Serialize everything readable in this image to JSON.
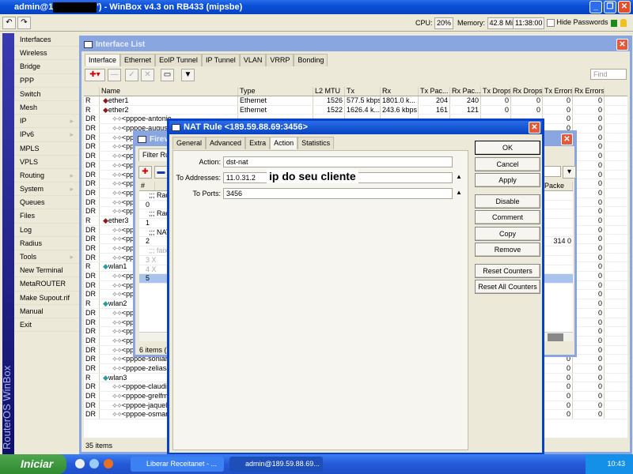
{
  "app": {
    "title_prefix": "admin@1",
    "title_suffix": "') - WinBox v4.3 on RB433 (mipsbe)"
  },
  "status": {
    "cpu_label": "CPU:",
    "cpu": "20%",
    "mem_label": "Memory:",
    "mem": "42.8 MiB",
    "time": "11:38:00",
    "hide_passwords": "Hide Passwords"
  },
  "sidebar": {
    "brand": "RouterOS WinBox",
    "items": [
      {
        "label": "Interfaces"
      },
      {
        "label": "Wireless"
      },
      {
        "label": "Bridge"
      },
      {
        "label": "PPP"
      },
      {
        "label": "Switch"
      },
      {
        "label": "Mesh"
      },
      {
        "label": "IP",
        "sub": true
      },
      {
        "label": "IPv6",
        "sub": true
      },
      {
        "label": "MPLS"
      },
      {
        "label": "VPLS"
      },
      {
        "label": "Routing",
        "sub": true
      },
      {
        "label": "System",
        "sub": true
      },
      {
        "label": "Queues"
      },
      {
        "label": "Files"
      },
      {
        "label": "Log"
      },
      {
        "label": "Radius"
      },
      {
        "label": "Tools",
        "sub": true
      },
      {
        "label": "New Terminal"
      },
      {
        "label": "MetaROUTER"
      },
      {
        "label": "Make Supout.rif"
      },
      {
        "label": "Manual"
      },
      {
        "label": "Exit"
      }
    ]
  },
  "iflist": {
    "title": "Interface List",
    "tabs": [
      "Interface",
      "Ethernet",
      "EoIP Tunnel",
      "IP Tunnel",
      "VLAN",
      "VRRP",
      "Bonding"
    ],
    "find_placeholder": "Find",
    "status": "35 items",
    "columns": [
      "",
      "Name",
      "Type",
      "L2 MTU",
      "Tx",
      "Rx",
      "Tx Pac...",
      "Rx Pac...",
      "Tx Drops",
      "Rx Drops",
      "Tx Errors",
      "Rx Errors"
    ],
    "rows": [
      [
        "R",
        "ether1",
        "Ethernet",
        "1526",
        "577.5 kbps",
        "1801.0 k...",
        "204",
        "240",
        "0",
        "0",
        "0",
        "0"
      ],
      [
        "R",
        "ether2",
        "Ethernet",
        "1522",
        "1626.4 k...",
        "243.6 kbps",
        "161",
        "121",
        "0",
        "0",
        "0",
        "0"
      ],
      [
        "DR",
        "<pppoe-antonio",
        "",
        "",
        "",
        "",
        "",
        "",
        "",
        "",
        "0",
        "0"
      ],
      [
        "DR",
        "<pppoe-augusto",
        "",
        "",
        "",
        "",
        "",
        "",
        "",
        "",
        "0",
        "0"
      ],
      [
        "DR",
        "<pp",
        "",
        "",
        "",
        "",
        "",
        "",
        "",
        "",
        "0",
        "0"
      ],
      [
        "DR",
        "<pp",
        "",
        "",
        "",
        "",
        "",
        "",
        "",
        "",
        "0",
        "0"
      ],
      [
        "DR",
        "<pp",
        "",
        "",
        "",
        "",
        "",
        "",
        "",
        "",
        "0",
        "0"
      ],
      [
        "DR",
        "<pp",
        "",
        "",
        "",
        "",
        "",
        "",
        "",
        "",
        "0",
        "0"
      ],
      [
        "DR",
        "<pp",
        "",
        "",
        "",
        "",
        "",
        "",
        "",
        "",
        "0",
        "0"
      ],
      [
        "DR",
        "<pp",
        "",
        "",
        "",
        "",
        "",
        "",
        "",
        "",
        "0",
        "0"
      ],
      [
        "DR",
        "<pp",
        "",
        "",
        "",
        "",
        "",
        "",
        "",
        "",
        "0",
        "0"
      ],
      [
        "DR",
        "<pp",
        "",
        "",
        "",
        "",
        "",
        "",
        "",
        "",
        "0",
        "0"
      ],
      [
        "DR",
        "<pp",
        "",
        "",
        "",
        "",
        "",
        "",
        "",
        "",
        "0",
        "0"
      ],
      [
        "R",
        "ether3",
        "",
        "",
        "",
        "",
        "",
        "",
        "",
        "",
        "0",
        "0"
      ],
      [
        "DR",
        "<pp",
        "",
        "",
        "",
        "",
        "",
        "",
        "",
        "",
        "0",
        "0"
      ],
      [
        "DR",
        "<pp",
        "",
        "",
        "",
        "",
        "",
        "",
        "",
        "",
        "0",
        "0"
      ],
      [
        "DR",
        "<pp",
        "",
        "",
        "",
        "",
        "",
        "",
        "",
        "",
        "0",
        "0"
      ],
      [
        "DR",
        "<pp",
        "",
        "",
        "",
        "",
        "",
        "",
        "",
        "",
        "0",
        "0"
      ],
      [
        "R",
        "wlan1",
        "",
        "",
        "",
        "",
        "",
        "",
        "",
        "",
        "0",
        "0"
      ],
      [
        "DR",
        "<pp",
        "",
        "",
        "",
        "",
        "",
        "",
        "",
        "",
        "0",
        "0"
      ],
      [
        "DR",
        "<pp",
        "",
        "",
        "",
        "",
        "",
        "",
        "",
        "",
        "0",
        "0"
      ],
      [
        "DR",
        "<pp",
        "",
        "",
        "",
        "",
        "",
        "",
        "",
        "",
        "0",
        "0"
      ],
      [
        "R",
        "wlan2",
        "",
        "",
        "",
        "",
        "",
        "",
        "",
        "",
        "0",
        "0"
      ],
      [
        "DR",
        "<pp",
        "",
        "",
        "",
        "",
        "",
        "",
        "",
        "",
        "0",
        "0"
      ],
      [
        "DR",
        "<pp",
        "",
        "",
        "",
        "",
        "",
        "",
        "",
        "",
        "0",
        "0"
      ],
      [
        "DR",
        "<pp",
        "",
        "",
        "",
        "",
        "",
        "",
        "",
        "",
        "0",
        "0"
      ],
      [
        "DR",
        "<pp",
        "",
        "",
        "",
        "",
        "",
        "",
        "",
        "",
        "0",
        "0"
      ],
      [
        "DR",
        "<pp",
        "",
        "",
        "",
        "",
        "",
        "",
        "",
        "",
        "0",
        "0"
      ],
      [
        "DR",
        "<pppoe-soniaro",
        "",
        "",
        "",
        "",
        "",
        "",
        "",
        "",
        "0",
        "0"
      ],
      [
        "DR",
        "<pppoe-zeliasar",
        "",
        "",
        "",
        "",
        "",
        "",
        "",
        "",
        "0",
        "0"
      ],
      [
        "R",
        "wlan3",
        "",
        "",
        "",
        "",
        "",
        "",
        "",
        "",
        "0",
        "0"
      ],
      [
        "DR",
        "<pppoe-claudio",
        "",
        "",
        "",
        "",
        "",
        "",
        "",
        "",
        "0",
        "0"
      ],
      [
        "DR",
        "<pppoe-grelfms",
        "",
        "",
        "",
        "",
        "",
        "",
        "",
        "",
        "0",
        "0"
      ],
      [
        "DR",
        "<pppoe-jaquelin",
        "",
        "",
        "",
        "",
        "",
        "",
        "",
        "",
        "0",
        "0"
      ],
      [
        "DR",
        "<pppoe-osmar@",
        "",
        "",
        "",
        "",
        "",
        "",
        "",
        "",
        "0",
        "0"
      ]
    ]
  },
  "firewall": {
    "title": "Firev",
    "tab": "Filter Rule",
    "col_num": "#",
    "col_packets": "Packe",
    "status": "6 items (1",
    "rows": [
      {
        "t": ";;; Rad",
        "c": "comment"
      },
      {
        "t": "0"
      },
      {
        "t": ";;; Rad",
        "c": "comment"
      },
      {
        "t": "1"
      },
      {
        "t": ";;; NAT",
        "c": "comment"
      },
      {
        "t": "2",
        "p": "314 0"
      },
      {
        "t": ";;; faixa",
        "c": "disabled"
      },
      {
        "t": "3 X",
        "c": "disabled"
      },
      {
        "t": "4 X",
        "c": "disabled"
      },
      {
        "t": "5",
        "c": "selected"
      }
    ]
  },
  "nat": {
    "title": "NAT Rule <189.59.88.69:3456>",
    "tabs": [
      "General",
      "Advanced",
      "Extra",
      "Action",
      "Statistics"
    ],
    "action_label": "Action:",
    "action": "dst-nat",
    "to_addr_label": "To Addresses:",
    "to_addr": "11.0.31.2",
    "to_ports_label": "To Ports:",
    "to_ports": "3456",
    "annotation": "ip do seu cliente",
    "buttons": [
      "OK",
      "Cancel",
      "Apply",
      "Disable",
      "Comment",
      "Copy",
      "Remove",
      "Reset Counters",
      "Reset All Counters"
    ]
  },
  "taskbar": {
    "start": "Iniciar",
    "tasks": [
      "Liberar Receitanet - ...",
      "admin@189.59.88.69..."
    ],
    "clock": "10:43"
  }
}
